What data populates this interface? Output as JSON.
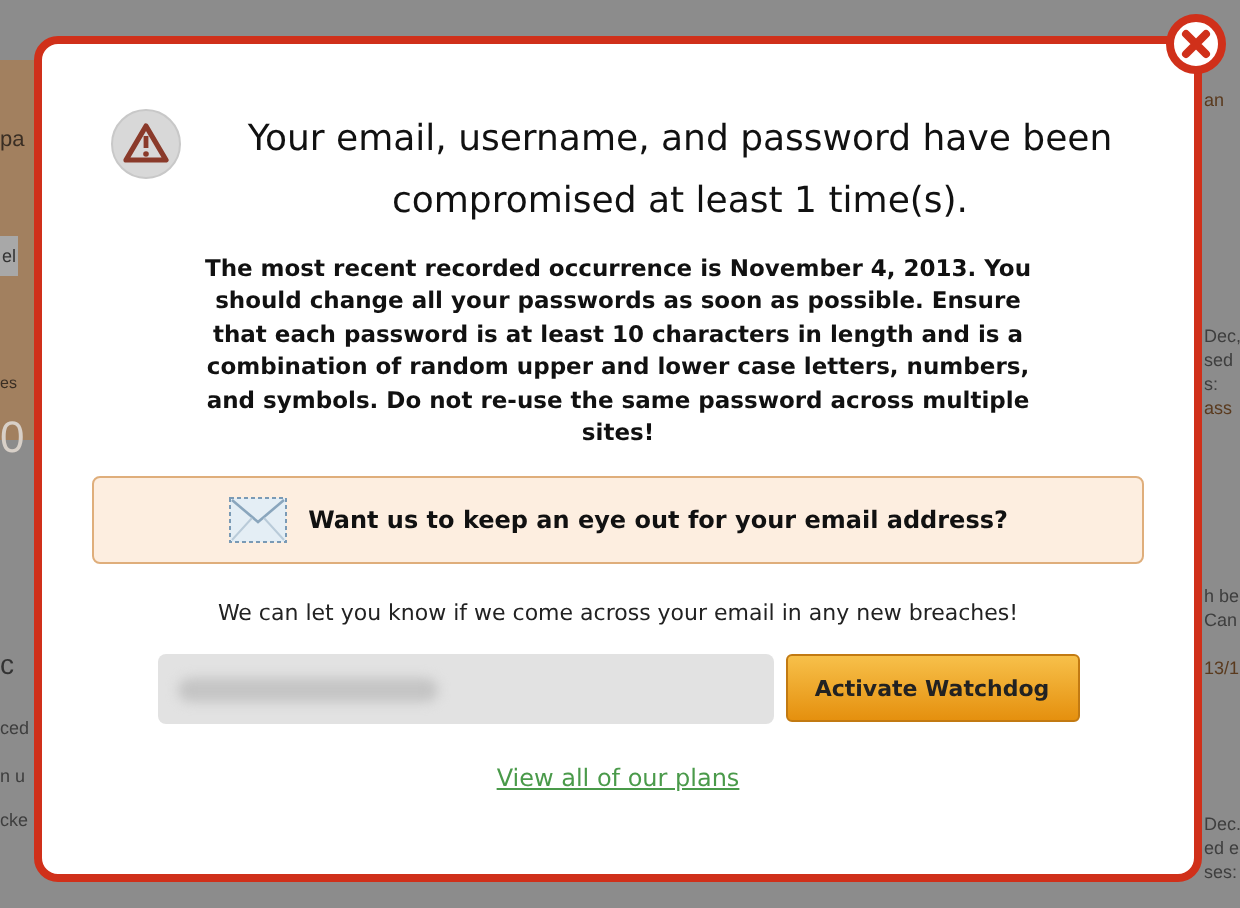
{
  "background": {
    "left_fragments": [
      {
        "text": "pa",
        "kind": "band"
      },
      {
        "text": "el",
        "kind": "field"
      },
      {
        "text": "es",
        "kind": "small"
      },
      {
        "text": "0",
        "kind": "big"
      },
      {
        "text": "c",
        "kind": "heading"
      },
      {
        "text": "ced",
        "kind": "text"
      },
      {
        "text": "n u",
        "kind": "text"
      },
      {
        "text": "cke",
        "kind": "text"
      }
    ],
    "right_fragments": [
      {
        "text": "an",
        "kind": "link"
      },
      {
        "text": "Dec,",
        "kind": "text"
      },
      {
        "text": "sed",
        "kind": "text"
      },
      {
        "text": "s:",
        "kind": "text"
      },
      {
        "text": "ass",
        "kind": "link"
      },
      {
        "text": "h be",
        "kind": "text"
      },
      {
        "text": "Can",
        "kind": "text"
      },
      {
        "text": "13/1",
        "kind": "link"
      },
      {
        "text": "Dec.",
        "kind": "text"
      },
      {
        "text": "ed e",
        "kind": "text"
      },
      {
        "text": "ses:",
        "kind": "text"
      }
    ]
  },
  "dialog": {
    "title": "Your email, username, and password have been compromised at least 1 time(s).",
    "body": "The most recent recorded occurrence is November 4, 2013. You should change all your passwords as soon as possible. Ensure that each password is at least 10 characters in length and is a combination of random upper and lower case letters, numbers, and symbols. Do not re-use the same password across multiple sites!",
    "callout": "Want us to keep an eye out for your email address?",
    "note": "We can let you know if we come across your email in any new breaches!",
    "email_field": {
      "blurred": true
    },
    "button": "Activate Watchdog",
    "link": "View all of our plans"
  }
}
